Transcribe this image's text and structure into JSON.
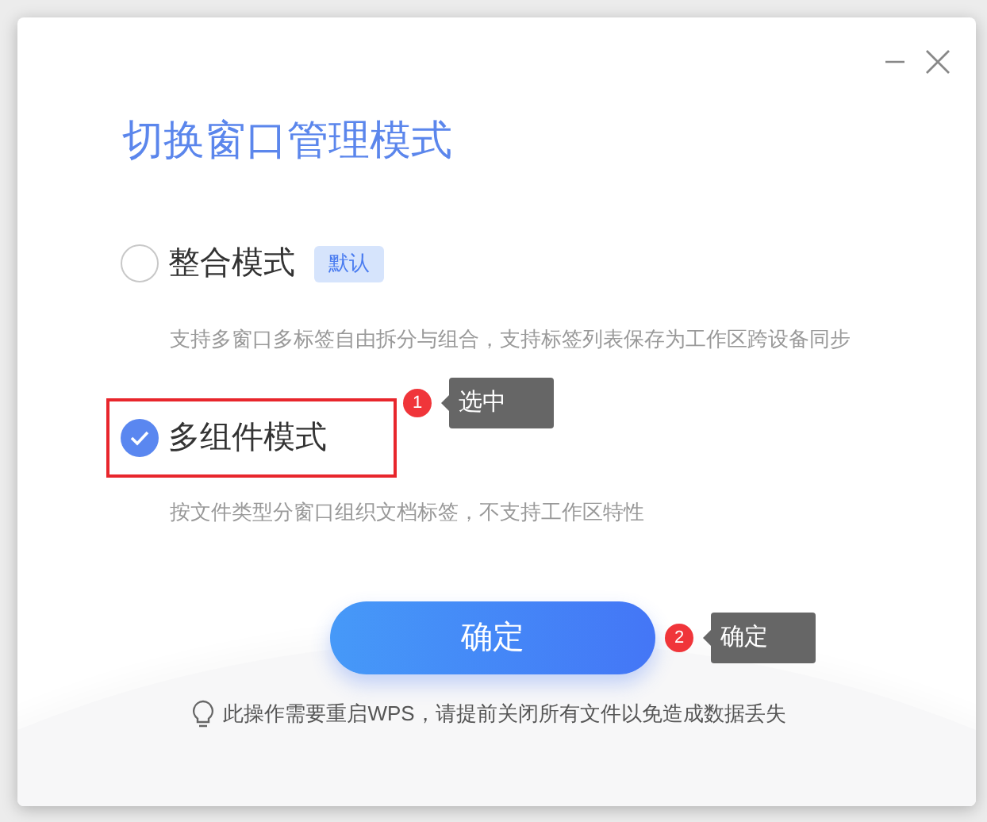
{
  "window": {
    "title": "切换窗口管理模式"
  },
  "options": [
    {
      "label": "整合模式",
      "badge": "默认",
      "description": "支持多窗口多标签自由拆分与组合，支持标签列表保存为工作区跨设备同步",
      "selected": false,
      "highlighted": false
    },
    {
      "label": "多组件模式",
      "description": "按文件类型分窗口组织文档标签，不支持工作区特性",
      "selected": true,
      "highlighted": true
    }
  ],
  "confirm_button": {
    "label": "确定"
  },
  "annotations": [
    {
      "number": "1",
      "text": "选中"
    },
    {
      "number": "2",
      "text": "确定"
    }
  ],
  "notice": "此操作需要重启WPS，请提前关闭所有文件以免造成数据丢失"
}
